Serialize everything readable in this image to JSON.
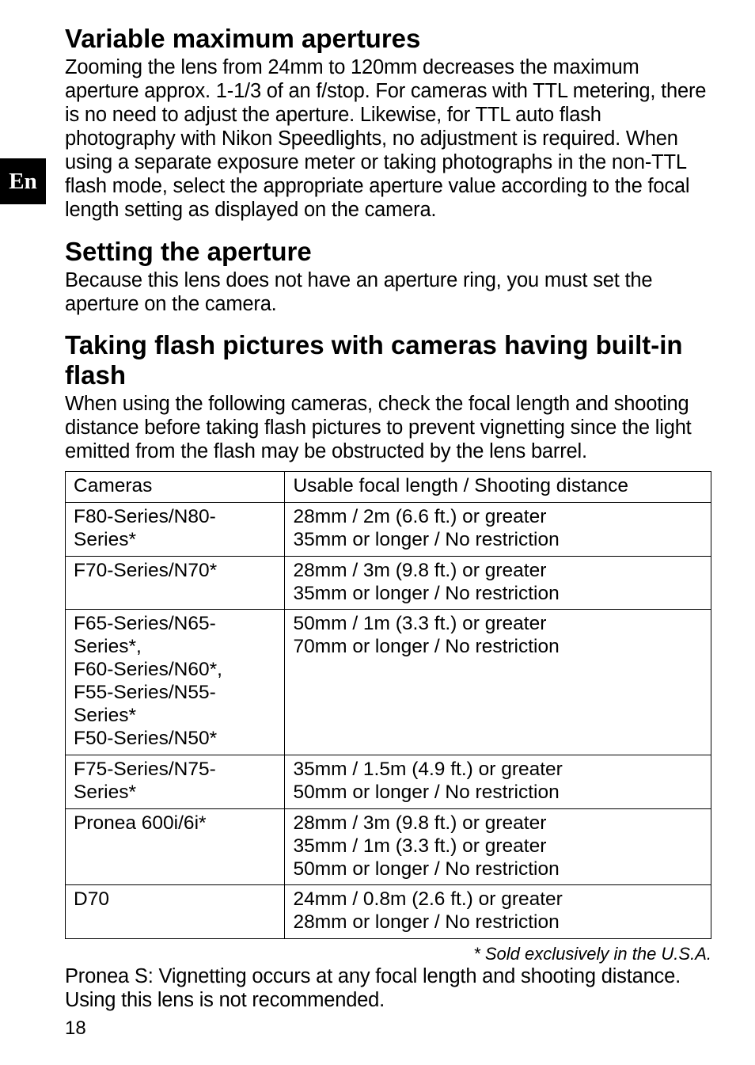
{
  "lang_tab": "En",
  "sections": {
    "variable_apertures": {
      "heading": "Variable maximum apertures",
      "body": "Zooming the lens from 24mm to 120mm decreases the maximum aperture approx. 1-1/3 of an f/stop. For cameras with TTL metering, there is no need to adjust the aperture. Likewise, for TTL auto flash photography with Nikon Speedlights, no adjustment is required. When using a separate exposure meter or taking photographs in the non-TTL flash mode, select the appropriate aperture value according to the focal length setting as displayed on the camera."
    },
    "setting_aperture": {
      "heading": "Setting the aperture",
      "body": "Because this lens does not have an aperture ring, you must set the aperture on the camera."
    },
    "flash": {
      "heading": "Taking flash pictures with cameras having built-in flash",
      "body": "When using the following cameras, check the focal length and shooting distance before taking flash pictures to prevent vignetting since the light emitted from the flash may be obstructed by the lens barrel."
    }
  },
  "table": {
    "headers": {
      "col1": "Cameras",
      "col2": "Usable focal length / Shooting distance"
    },
    "rows": [
      {
        "camera": "F80-Series/N80-Series*",
        "usable": "28mm / 2m (6.6 ft.) or greater\n35mm or longer / No restriction"
      },
      {
        "camera": "F70-Series/N70*",
        "usable": "28mm / 3m (9.8 ft.) or greater\n35mm or longer / No restriction"
      },
      {
        "camera": "F65-Series/N65-Series*,\nF60-Series/N60*,\nF55-Series/N55-Series*\nF50-Series/N50*",
        "usable": "50mm / 1m (3.3 ft.) or greater\n70mm or longer / No restriction"
      },
      {
        "camera": "F75-Series/N75-Series*",
        "usable": "35mm / 1.5m (4.9 ft.) or greater\n50mm or longer / No restriction"
      },
      {
        "camera": "Pronea 600i/6i*",
        "usable": "28mm / 3m (9.8 ft.) or greater\n35mm / 1m (3.3 ft.) or greater\n50mm or longer / No restriction"
      },
      {
        "camera": "D70",
        "usable": "24mm / 0.8m (2.6 ft.) or greater\n28mm or longer / No restriction"
      }
    ]
  },
  "footnote": "* Sold exclusively in the U.S.A.",
  "note": "Pronea S: Vignetting occurs at any focal length and shooting distance. Using this lens is not recommended.",
  "page_number": "18"
}
